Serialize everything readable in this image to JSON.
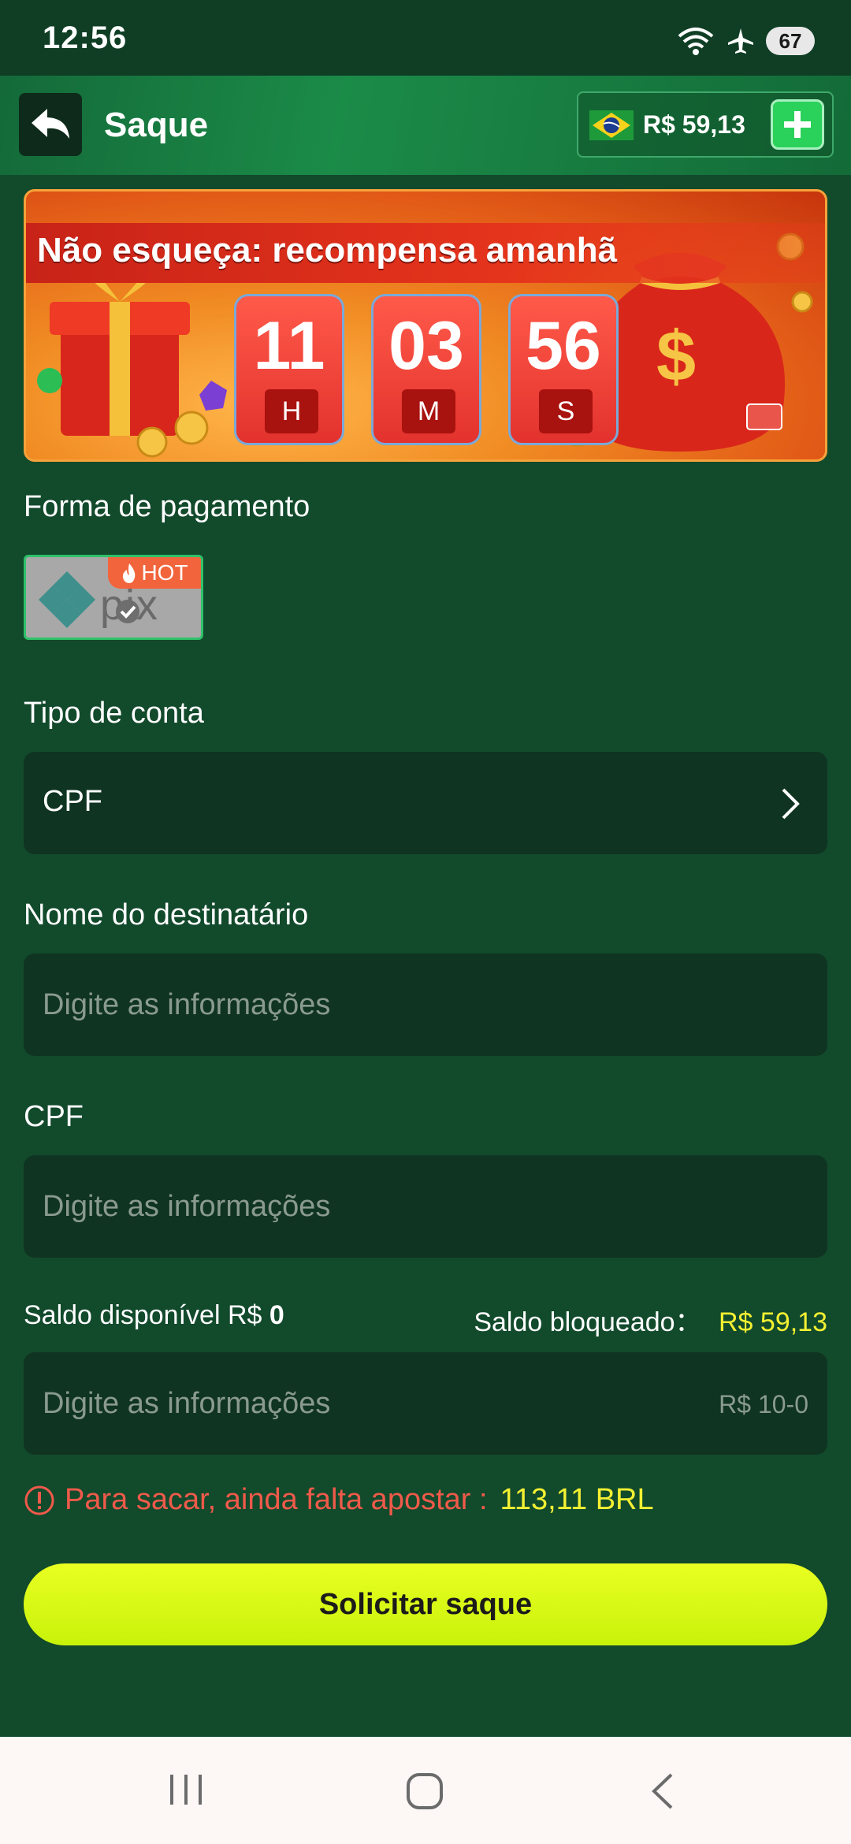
{
  "status_bar": {
    "time": "12:56",
    "battery": "67",
    "icons": [
      "wifi-icon",
      "airplane-icon",
      "battery-icon"
    ]
  },
  "header": {
    "title": "Saque",
    "balance": "R$ 59,13",
    "icons": [
      "back-icon",
      "brazil-flag-icon",
      "plus-icon"
    ]
  },
  "banner": {
    "title": "Não esqueça: recompensa amanhã",
    "hours": "11",
    "minutes": "03",
    "seconds": "56",
    "hours_unit": "H",
    "minutes_unit": "M",
    "seconds_unit": "S"
  },
  "payment": {
    "label": "Forma de pagamento",
    "method_text": "pix",
    "badge": "HOT"
  },
  "account_type": {
    "label": "Tipo de conta",
    "value": "CPF"
  },
  "recipient": {
    "label": "Nome do destinatário",
    "placeholder": "Digite as informações"
  },
  "cpf": {
    "label": "CPF",
    "placeholder": "Digite as informações"
  },
  "balances": {
    "available_label": "Saldo disponível R$",
    "available_value": "0",
    "blocked_label": "Saldo bloqueado：",
    "blocked_value": "R$ 59,13"
  },
  "amount": {
    "placeholder": "Digite as informações",
    "range": "R$ 10-0"
  },
  "warning": {
    "text": "Para sacar, ainda falta apostar :",
    "amount": "113,11 BRL"
  },
  "submit": {
    "label": "Solicitar saque"
  },
  "colors": {
    "background": "#124a2c",
    "accent_yellow": "#f4f032",
    "warning_red": "#f05a4a",
    "button": "#e3ff1a"
  }
}
